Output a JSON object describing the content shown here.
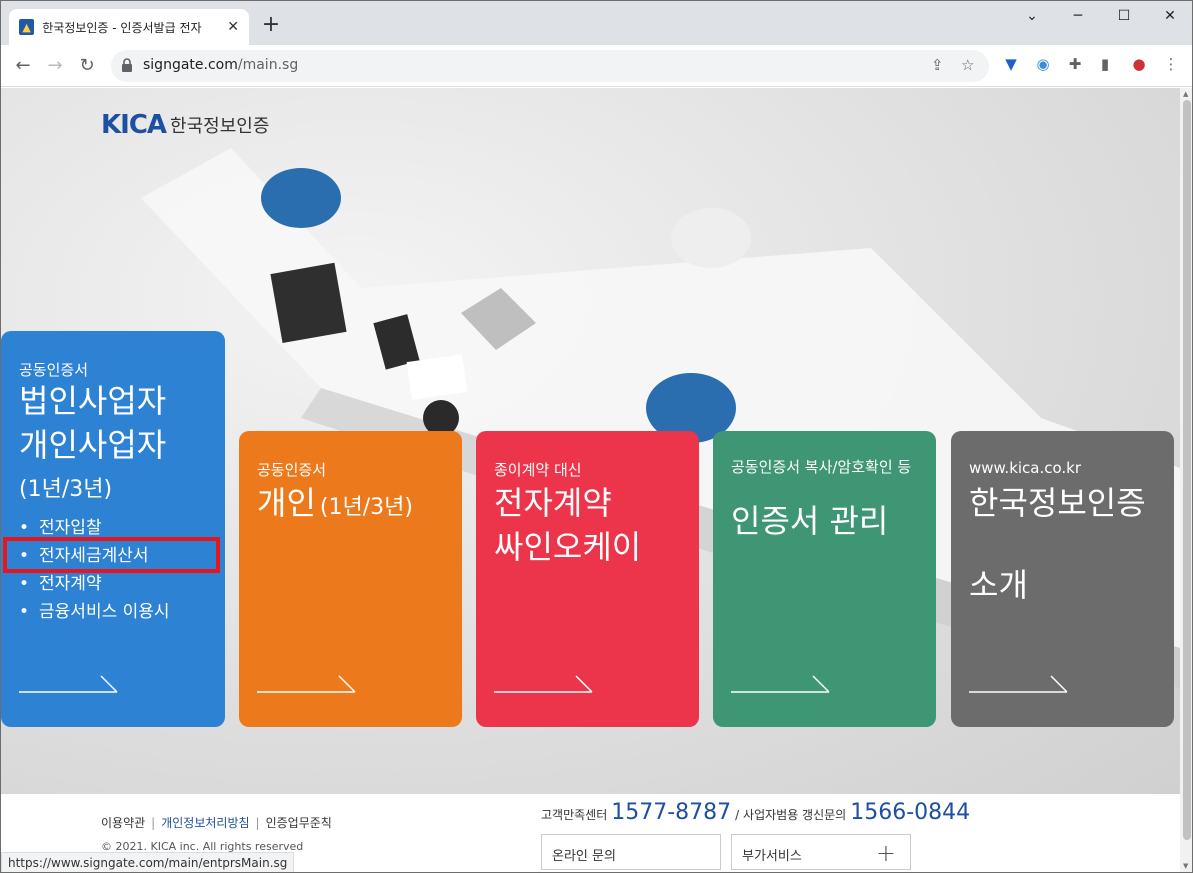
{
  "browser": {
    "tab_title": "한국정보인증 - 인증서발급 전자",
    "new_tab": "+",
    "url_host": "signgate.com",
    "url_path": "/main.sg"
  },
  "page": {
    "logo_mark": "KICA",
    "logo_text": "한국정보인증",
    "cards": {
      "blue": {
        "small": "공동인증서",
        "big_line1": "법인사업자",
        "big_line2": "개인사업자",
        "sub": "(1년/3년)",
        "bullets": [
          "전자입찰",
          "전자세금계산서",
          "전자계약",
          "금융서비스 이용시"
        ]
      },
      "orange": {
        "small": "공동인증서",
        "big": "개인",
        "sub": "(1년/3년)"
      },
      "red": {
        "small": "종이계약 대신",
        "big_line1": "전자계약",
        "big_line2": "싸인오케이"
      },
      "green": {
        "small": "공동인증서 복사/암호확인 등",
        "big": "인증서 관리"
      },
      "gray": {
        "small": "www.kica.co.kr",
        "big_line1": "한국정보인증",
        "big_line2": "소개"
      }
    },
    "footer": {
      "link1": "이용약관",
      "link2": "개인정보처리방침",
      "link3": "인증업무준칙",
      "copyright": "© 2021. KICA inc. All rights reserved",
      "contact_label1": "고객만족센터",
      "contact_num1": "1577-8787",
      "contact_label2": "/ 사업자범용 갱신문의",
      "contact_num2": "1566-0844",
      "box1": "온라인 문의",
      "box2": "부가서비스"
    }
  },
  "status_url": "https://www.signgate.com/main/entprsMain.sg"
}
